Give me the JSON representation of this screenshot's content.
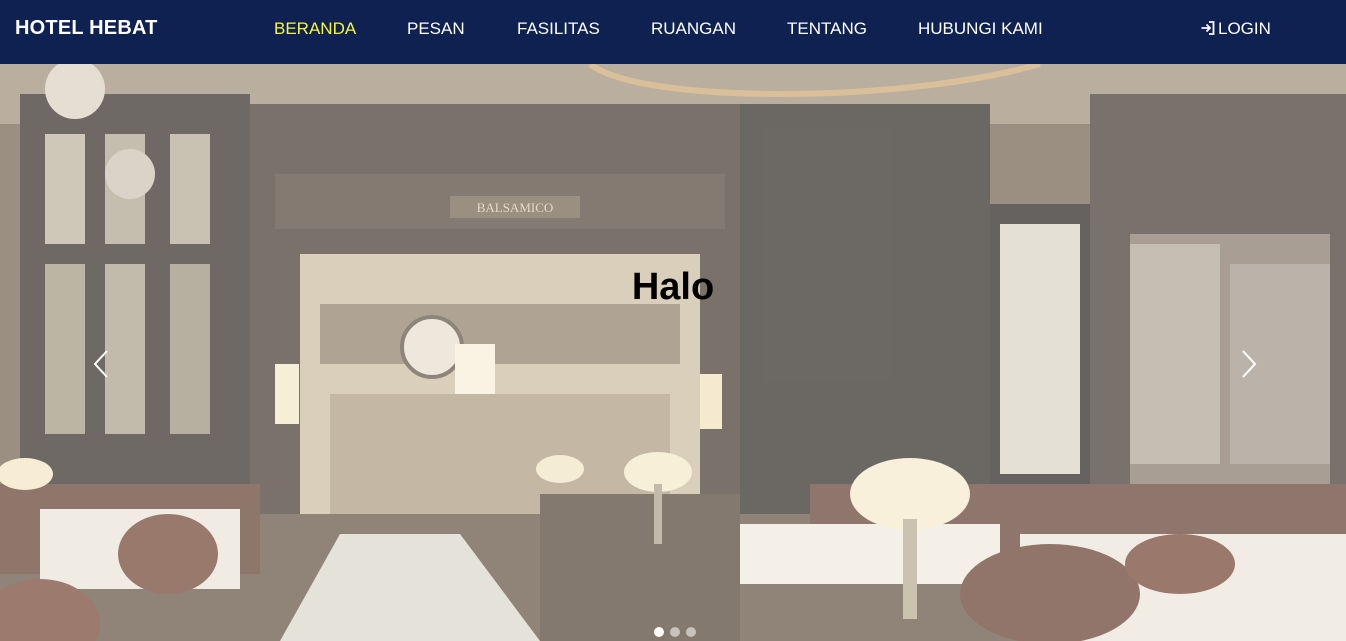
{
  "brand": "HOTEL HEBAT",
  "nav": {
    "items": [
      {
        "label": "BERANDA"
      },
      {
        "label": "PESAN"
      },
      {
        "label": "FASILITAS"
      },
      {
        "label": "RUANGAN"
      },
      {
        "label": "TENTANG"
      },
      {
        "label": "HUBUNGI KAMI"
      }
    ],
    "active": "BERANDA",
    "login": "LOGIN"
  },
  "carousel": {
    "caption": "Halo",
    "sign_text": "BALSAMICO",
    "slide_count": 3,
    "active_slide": 1
  },
  "colors": {
    "navbar": "#0e2150",
    "active_link": "#f5f542",
    "text": "#ffffff"
  }
}
